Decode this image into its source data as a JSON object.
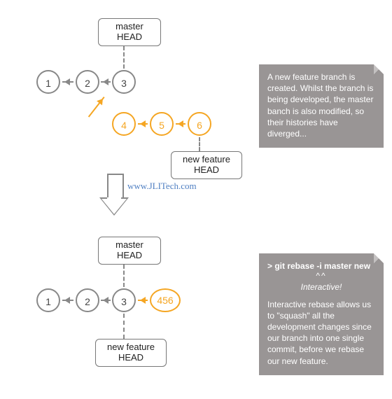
{
  "top": {
    "master_head": "master\nHEAD",
    "commits_master": [
      "1",
      "2",
      "3"
    ],
    "commits_feature": [
      "4",
      "5",
      "6"
    ],
    "feature_head": "new feature\nHEAD",
    "note": "A new feature branch is created. Whilst the branch is being developed, the master banch is also modified, so their histories have diverged..."
  },
  "watermark": "www.JLITech.com",
  "bottom": {
    "master_head": "master\nHEAD",
    "commits_master": [
      "1",
      "2",
      "3"
    ],
    "squashed_commit": "456",
    "feature_head": "new feature\nHEAD",
    "note_cmd": "> git rebase -i master new",
    "note_arrows": "^^",
    "note_interactive": "Interactive!",
    "note_body": "Interactive rebase allows us to \"squash\" all the development changes since our branch into one single commit, before we rebase our new feature."
  },
  "colors": {
    "orange": "#f5a623",
    "grey": "#888888",
    "note_bg": "#999595"
  }
}
